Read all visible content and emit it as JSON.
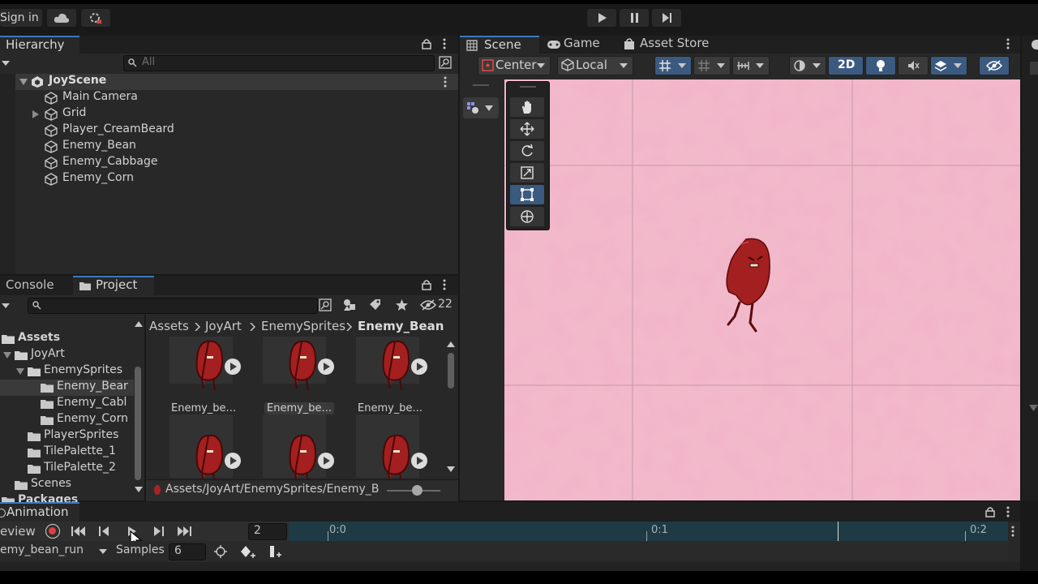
{
  "toolbar": {
    "sign_in": "Sign in"
  },
  "hierarchy": {
    "tab": "Hierarchy",
    "search_placeholder": "All",
    "scene_name": "JoyScene",
    "items": [
      "Main Camera",
      "Grid",
      "Player_CreamBeard",
      "Enemy_Bean",
      "Enemy_Cabbage",
      "Enemy_Corn"
    ]
  },
  "console_tab": "Console",
  "project": {
    "tab": "Project",
    "hidden_count": "22",
    "tree": [
      "Assets",
      "JoyArt",
      "EnemySprites",
      "Enemy_Bear",
      "Enemy_Cabl",
      "Enemy_Corn",
      "PlayerSprites",
      "TilePalette_1",
      "TilePalette_2",
      "Scenes",
      "Packages"
    ],
    "breadcrumb": [
      "Assets",
      "JoyArt",
      "EnemySprites",
      "Enemy_Bean"
    ],
    "assets": [
      "Enemy_be...",
      "Enemy_be...",
      "Enemy_be..."
    ],
    "status_path": "Assets/JoyArt/EnemySprites/Enemy_B"
  },
  "scene": {
    "tabs": [
      "Scene",
      "Game",
      "Asset Store"
    ],
    "pivot": "Center",
    "space": "Local",
    "mode_2d": "2D",
    "background_color": "#f2b9cb"
  },
  "animation": {
    "tab": "Animation",
    "preview": "eview",
    "frame": "2",
    "clip": "emy_bean_run",
    "samples_label": "Samples",
    "samples": "6",
    "ruler": [
      "0:0",
      "0:1",
      "0:2"
    ]
  }
}
